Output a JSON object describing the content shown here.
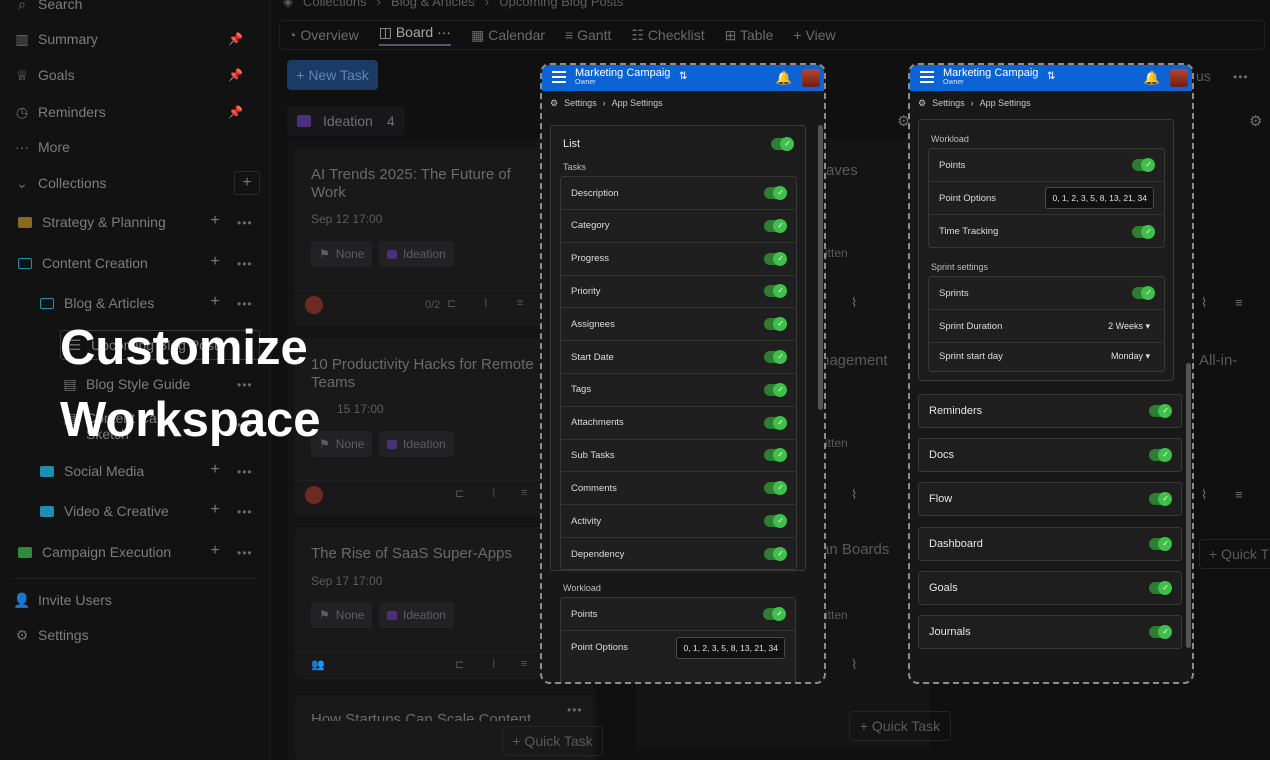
{
  "sidebar": {
    "search": "Search",
    "summary": "Summary",
    "goals": "Goals",
    "reminders": "Reminders",
    "more": "More",
    "collections": "Collections",
    "strategy": "Strategy & Planning",
    "content": "Content Creation",
    "blog": "Blog & Articles",
    "upcoming": "Upcoming Blog Posts",
    "style_guide": "Blog Style Guide",
    "sketch": "Sketch",
    "sketch_prefix": "Content Ca",
    "social": "Social Media",
    "video": "Video & Creative",
    "campaign": "Campaign Execution",
    "invite": "Invite Users",
    "settings": "Settings"
  },
  "breadcrumb": {
    "c1": "Collections",
    "c2": "Blog & Articles",
    "c3": "Upcoming Blog Posts"
  },
  "views": {
    "overview": "Overview",
    "board": "Board",
    "calendar": "Calendar",
    "gantt": "Gantt",
    "checklist": "Checklist",
    "table": "Table",
    "add": "+ View"
  },
  "board": {
    "new_task": "+ New Task",
    "column": "Ideation",
    "column_count": "4",
    "quick_task": "+ Quick Task",
    "quick_task_short": "+ Quick T",
    "status_frag": "us",
    "cards": [
      {
        "title": "AI Trends 2025: The Future of Work",
        "date": "Sep 12 17:00",
        "priority": "None",
        "status": "Ideation",
        "sub": "0/2"
      },
      {
        "title": "10 Productivity Hacks for Remote Teams",
        "date": "Sep 15 17:00",
        "date_frag": "15 17:00",
        "priority": "None",
        "status": "Ideation"
      },
      {
        "title": "The Rise of SaaS Super-Apps",
        "date": "Sep 17 17:00",
        "priority": "None",
        "status": "Ideation"
      },
      {
        "title": "How Startups Can Scale Content"
      }
    ],
    "ghost": {
      "g1": "Saves",
      "g2": "nagement",
      "g3": "an Boards",
      "g4": "All-in-",
      "written": "ritten"
    }
  },
  "overlay": {
    "line1": "Customize",
    "line2": "Workspace"
  },
  "phone": {
    "title": "Marketing Campaig",
    "subtitle": "Owner",
    "bc_settings": "Settings",
    "bc_app": "App Settings",
    "list_label": "List",
    "tasks_label": "Tasks",
    "tasks": [
      "Description",
      "Category",
      "Progress",
      "Priority",
      "Assignees",
      "Start Date",
      "Tags",
      "Attachments",
      "Sub Tasks",
      "Comments",
      "Activity",
      "Dependency"
    ],
    "workload_label": "Workload",
    "points": "Points",
    "point_options": "Point Options",
    "point_values": "0, 1, 2, 3, 5, 8, 13, 21, 34",
    "time_tracking": "Time Tracking",
    "sprint_label": "Sprint settings",
    "sprints": "Sprints",
    "sprint_duration": "Sprint Duration",
    "sprint_duration_val": "2 Weeks",
    "sprint_start": "Sprint start day",
    "sprint_start_val": "Monday",
    "modules": [
      "Reminders",
      "Docs",
      "Flow",
      "Dashboard",
      "Goals",
      "Journals"
    ]
  },
  "colors": {
    "accent": "#0b63d6",
    "toggle": "#3ec04a",
    "ideation": "#4a2f7a"
  }
}
